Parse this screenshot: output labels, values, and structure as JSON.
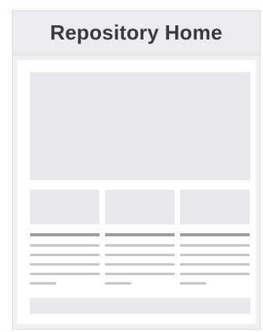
{
  "header": {
    "title": "Repository Home"
  },
  "wireframe": {
    "column_count": 3,
    "colors": {
      "background": "#f0f0f2",
      "header": "#ececee",
      "placeholder": "#e9e9ed",
      "heading_line": "#9d9da1",
      "text_line": "#c6c6ca"
    }
  }
}
